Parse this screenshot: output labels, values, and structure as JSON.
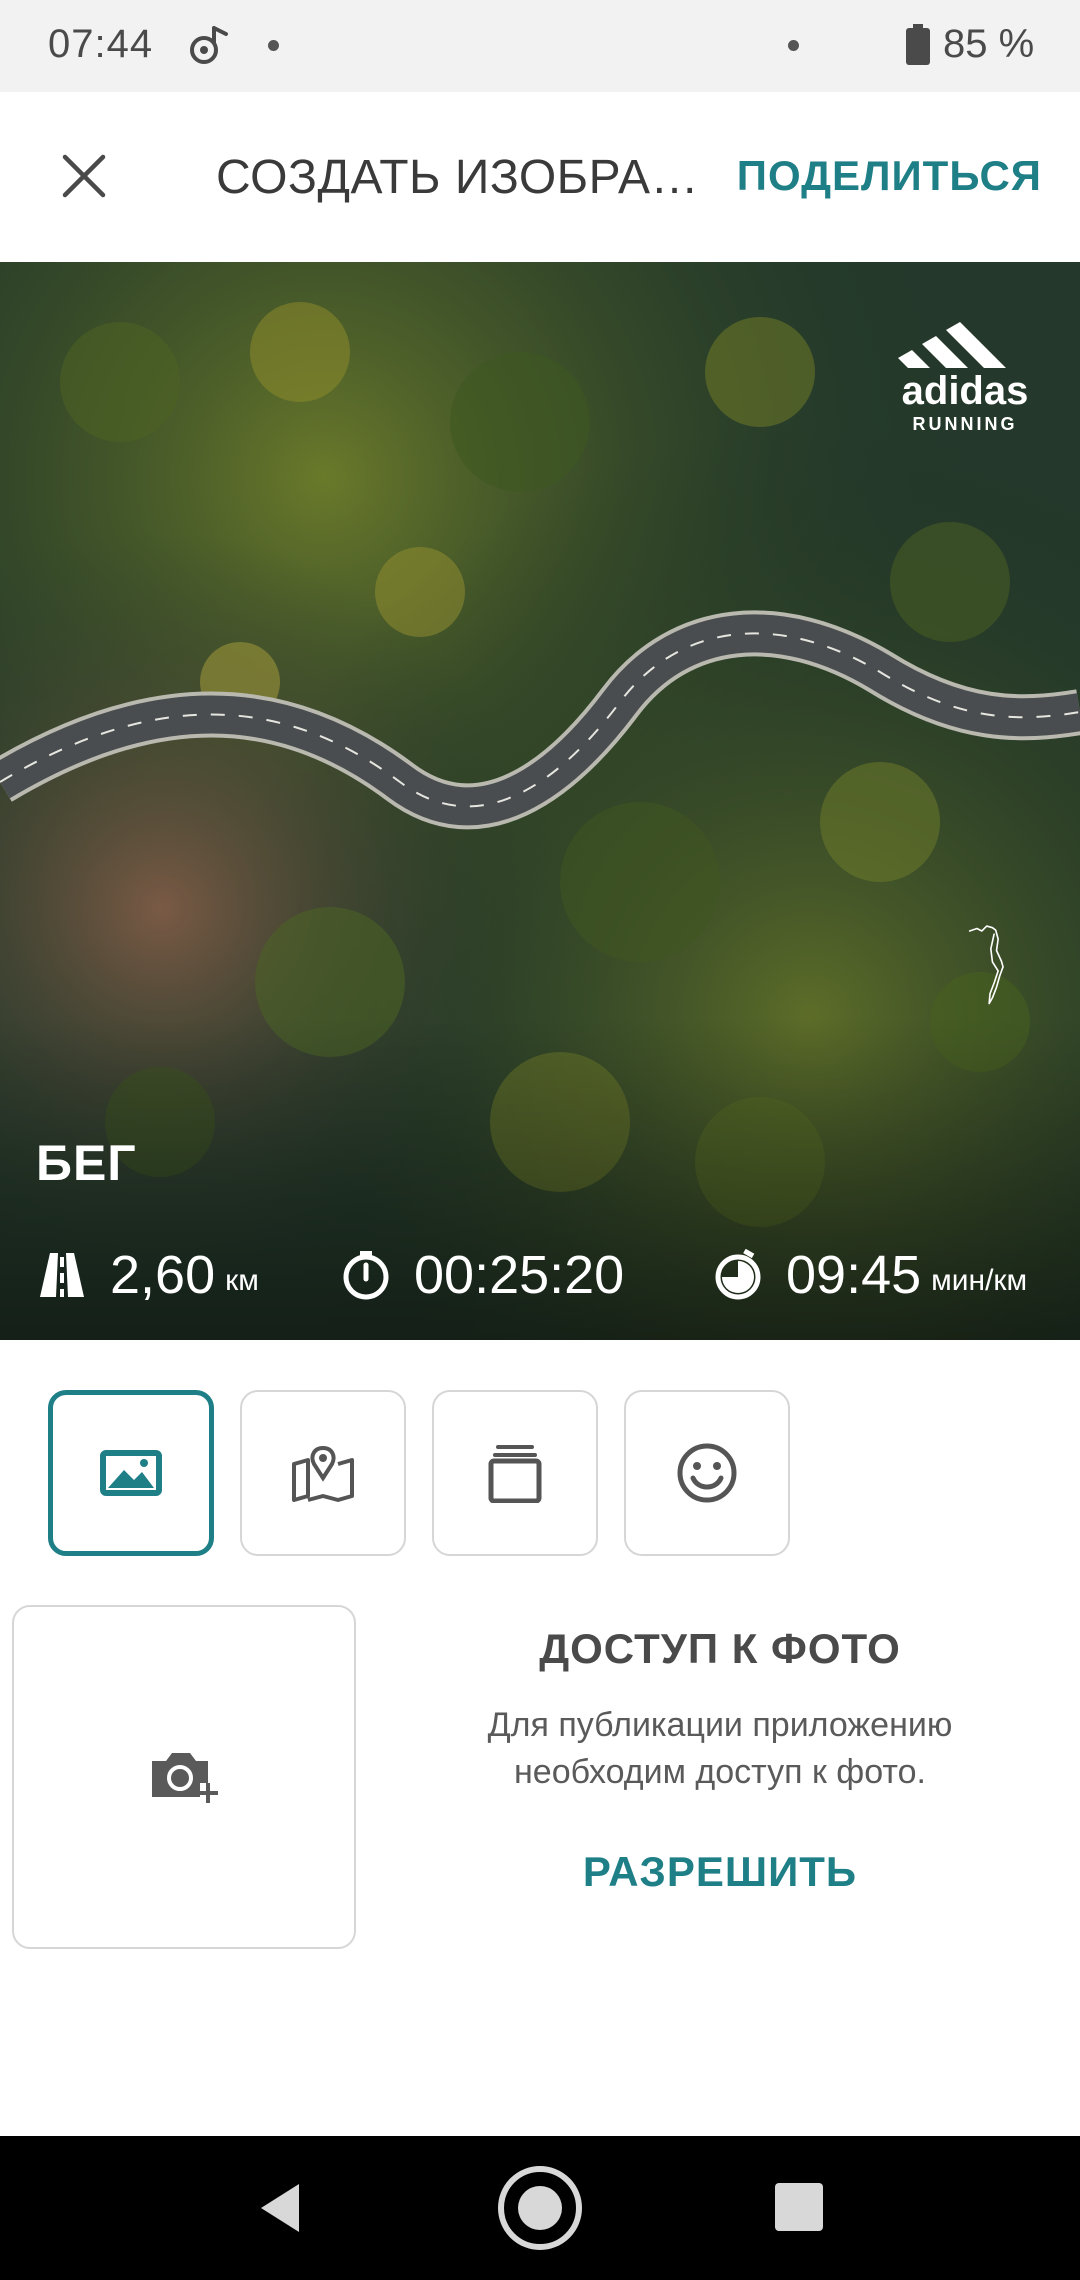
{
  "status_bar": {
    "time": "07:44",
    "battery": "85 %",
    "icons": [
      "music-note-icon",
      "battery-icon"
    ]
  },
  "app_bar": {
    "close_icon": "close-icon",
    "title": "СОЗДАТЬ ИЗОБРАЖ…",
    "share_label": "ПОДЕЛИТЬСЯ",
    "accent_color": "#1f7f87"
  },
  "hero": {
    "brand_name": "adidas",
    "brand_sub": "RUNNING",
    "activity": "БЕГ",
    "stats": {
      "distance_value": "2,60",
      "distance_unit": "км",
      "duration_value": "00:25:20",
      "pace_value": "09:45",
      "pace_unit": "мин/км"
    },
    "stat_icons": [
      "road-icon",
      "stopwatch-icon",
      "pace-icon"
    ]
  },
  "tabs": [
    {
      "icon": "image-icon",
      "active": true
    },
    {
      "icon": "map-icon",
      "active": false
    },
    {
      "icon": "layers-icon",
      "active": false
    },
    {
      "icon": "smiley-icon",
      "active": false
    }
  ],
  "photo_access": {
    "add_icon": "add-photo-camera-icon",
    "title": "ДОСТУП К ФОТО",
    "text_line1": "Для публикации приложению",
    "text_line2": "необходим доступ к фото.",
    "allow_label": "РАЗРЕШИТЬ"
  },
  "nav": {
    "icons": [
      "back-icon",
      "home-icon",
      "recents-icon"
    ]
  }
}
